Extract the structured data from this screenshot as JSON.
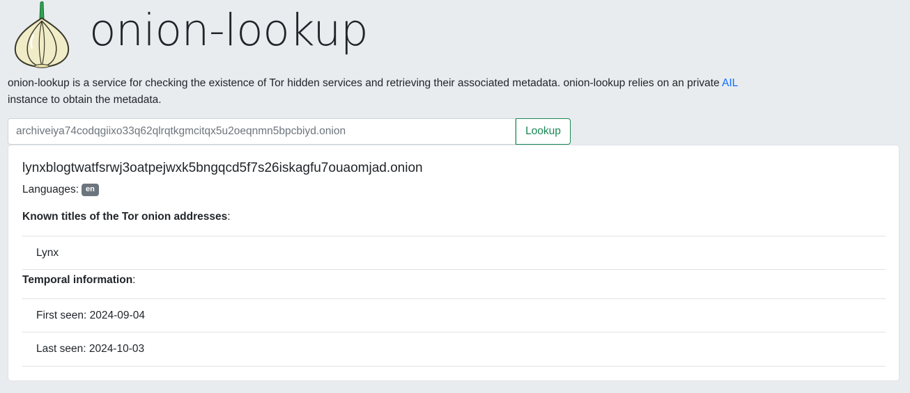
{
  "header": {
    "logo_icon": "garlic-onion-logo-icon",
    "title": "onion-lookup"
  },
  "intro": {
    "text_before": "onion-lookup is a service for checking the existence of Tor hidden services and retrieving their associated metadata. onion-lookup relies on an private ",
    "link_text": "AIL",
    "text_after": " instance to obtain the metadata."
  },
  "search": {
    "placeholder": "archiveiya74codqgiixo33q62qlrqtkgmcitqx5u2oeqnmn5bpcbiyd.onion",
    "value": "",
    "button_label": "Lookup"
  },
  "result": {
    "address": "lynxblogtwatfsrwj3oatpejwxk5bngqcd5f7s26iskagfu7ouaomjad.onion",
    "languages_label": "Languages:",
    "languages": [
      "en"
    ],
    "titles_label": "Known titles of the Tor onion addresses",
    "titles": [
      "Lynx"
    ],
    "temporal_label": "Temporal information",
    "first_seen": "First seen: 2024-09-04",
    "last_seen": "Last seen: 2024-10-03"
  },
  "colors": {
    "background": "#e9ecef",
    "link": "#0d6efd",
    "success": "#198754",
    "badge": "#6c757d"
  }
}
